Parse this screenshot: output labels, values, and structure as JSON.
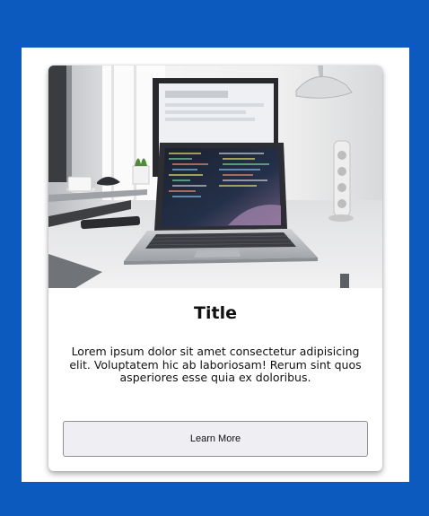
{
  "colors": {
    "page_background": "#0c5abd",
    "panel_background": "#ffffff",
    "button_background": "#efeff3"
  },
  "card": {
    "title": "Title",
    "text": "Lorem ipsum dolor sit amet consectetur adipisicing elit. Voluptatem hic ab laboriosam! Rerum sint quos asperiores esse quia ex doloribus.",
    "button_label": "Learn More"
  }
}
